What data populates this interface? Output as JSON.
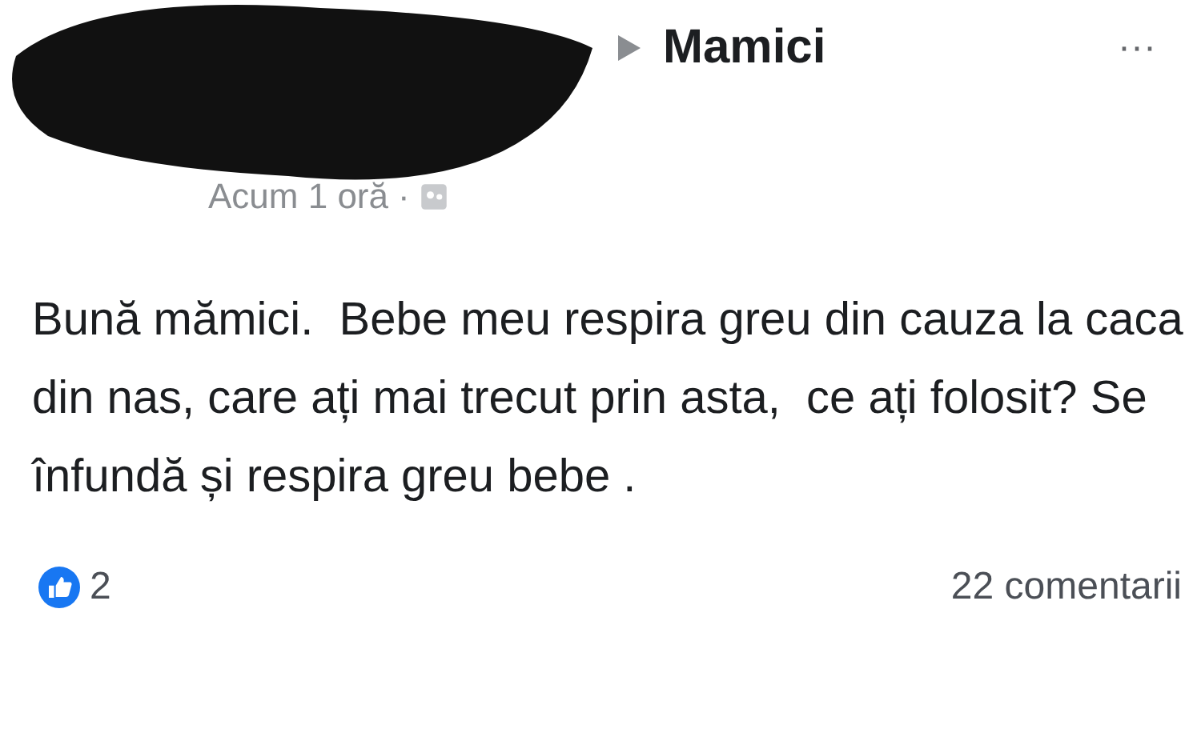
{
  "header": {
    "group": "Mamici",
    "more": "···",
    "time": "Acum 1 oră",
    "separator": "·"
  },
  "post": {
    "text": "Bună mămici.  Bebe meu respira greu din cauza la caca din nas, care ați mai trecut prin asta,  ce ați folosit? Se înfundă și respira greu bebe ."
  },
  "footer": {
    "reactions": "2",
    "comments": "22 comentarii"
  }
}
